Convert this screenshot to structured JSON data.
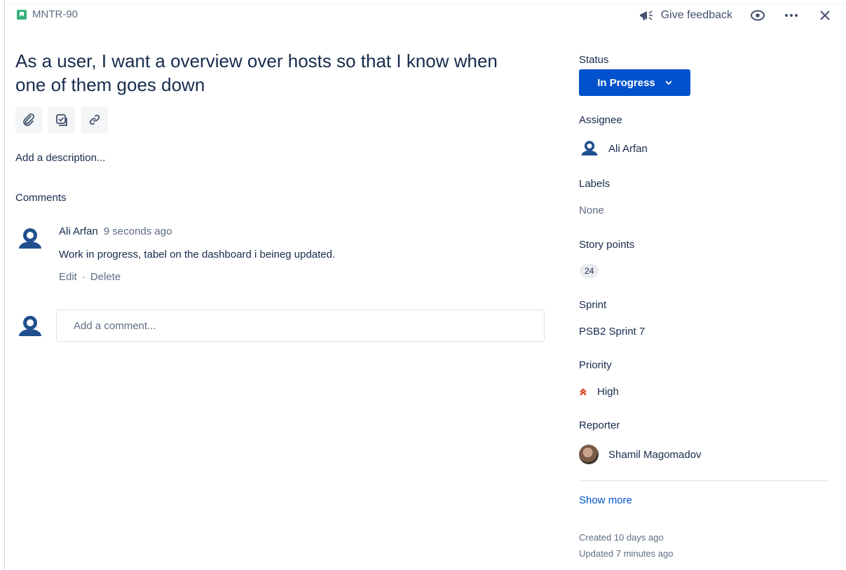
{
  "issue": {
    "key": "MNTR-90",
    "title": "As a user, I want a overview over hosts so that I know when one of them goes down"
  },
  "header": {
    "feedback_label": "Give feedback"
  },
  "main": {
    "description_placeholder": "Add a description...",
    "comments_heading": "Comments",
    "comment": {
      "author": "Ali Arfan",
      "time": "9 seconds ago",
      "body": "Work in progress, tabel on the dashboard i beineg updated.",
      "edit_label": "Edit",
      "separator": "·",
      "delete_label": "Delete"
    },
    "add_comment_placeholder": "Add a comment..."
  },
  "sidebar": {
    "status_label": "Status",
    "status_value": "In Progress",
    "assignee_label": "Assignee",
    "assignee_value": "Ali Arfan",
    "labels_label": "Labels",
    "labels_value": "None",
    "story_points_label": "Story points",
    "story_points_value": "24",
    "sprint_label": "Sprint",
    "sprint_value": "PSB2 Sprint 7",
    "priority_label": "Priority",
    "priority_value": "High",
    "reporter_label": "Reporter",
    "reporter_value": "Shamil Magomadov",
    "show_more": "Show more",
    "created": "Created 10 days ago",
    "updated": "Updated 7 minutes ago"
  },
  "colors": {
    "accent": "#0052cc",
    "story": "#36b37e",
    "priority_high": "#de350b",
    "text": "#172b4d",
    "muted": "#5e6c84"
  },
  "icons": [
    "story-icon",
    "megaphone-icon",
    "eye-icon",
    "more-icon",
    "close-icon",
    "attachment-icon",
    "checklist-icon",
    "link-icon",
    "avatar-icon",
    "chevron-down-icon",
    "priority-high-icon"
  ]
}
